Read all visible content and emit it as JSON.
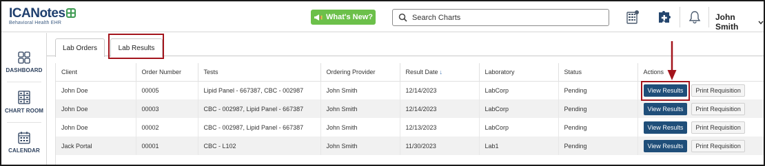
{
  "header": {
    "logo_text": "ICANotes",
    "logo_subtitle": "Behavioral Health EHR",
    "whats_new_label": "What's New?",
    "search_placeholder": "Search Charts",
    "user_name": "John Smith",
    "icons": [
      "calculator-icon",
      "puzzle-plus-icon",
      "bell-icon"
    ]
  },
  "sidebar": {
    "items": [
      {
        "label": "DASHBOARD",
        "icon": "dashboard-grid-icon"
      },
      {
        "label": "CHART ROOM",
        "icon": "file-cabinet-icon"
      },
      {
        "label": "CALENDAR",
        "icon": "calendar-icon"
      }
    ]
  },
  "tabs": [
    {
      "label": "Lab Orders",
      "active": false
    },
    {
      "label": "Lab Results",
      "active": true
    }
  ],
  "table": {
    "columns": [
      "Client",
      "Order Number",
      "Tests",
      "Ordering Provider",
      "Result Date",
      "Laboratory",
      "Status",
      "Actions"
    ],
    "sort_indicator": "↓",
    "rows": [
      {
        "client": "John Doe",
        "order": "00005",
        "tests": "Lipid Panel - 667387, CBC - 002987",
        "provider": "John Smith",
        "date": "12/14/2023",
        "lab": "LabCorp",
        "status": "Pending"
      },
      {
        "client": "John Doe",
        "order": "00003",
        "tests": "CBC - 002987, Lipid Panel - 667387",
        "provider": "John Smith",
        "date": "12/14/2023",
        "lab": "LabCorp",
        "status": "Pending"
      },
      {
        "client": "John Doe",
        "order": "00002",
        "tests": "CBC - 002987, Lipid Panel - 667387",
        "provider": "John Smith",
        "date": "12/13/2023",
        "lab": "LabCorp",
        "status": "Pending"
      },
      {
        "client": "Jack Portal",
        "order": "00001",
        "tests": "CBC - L102",
        "provider": "John Smith",
        "date": "11/30/2023",
        "lab": "Lab1",
        "status": "Pending"
      }
    ],
    "view_label": "View Results",
    "print_label": "Print Requisition"
  },
  "colors": {
    "brand_navy": "#1f3f6e",
    "brand_green": "#6cc04a",
    "button_navy": "#1f4e79",
    "highlight_red": "#a3141c"
  }
}
